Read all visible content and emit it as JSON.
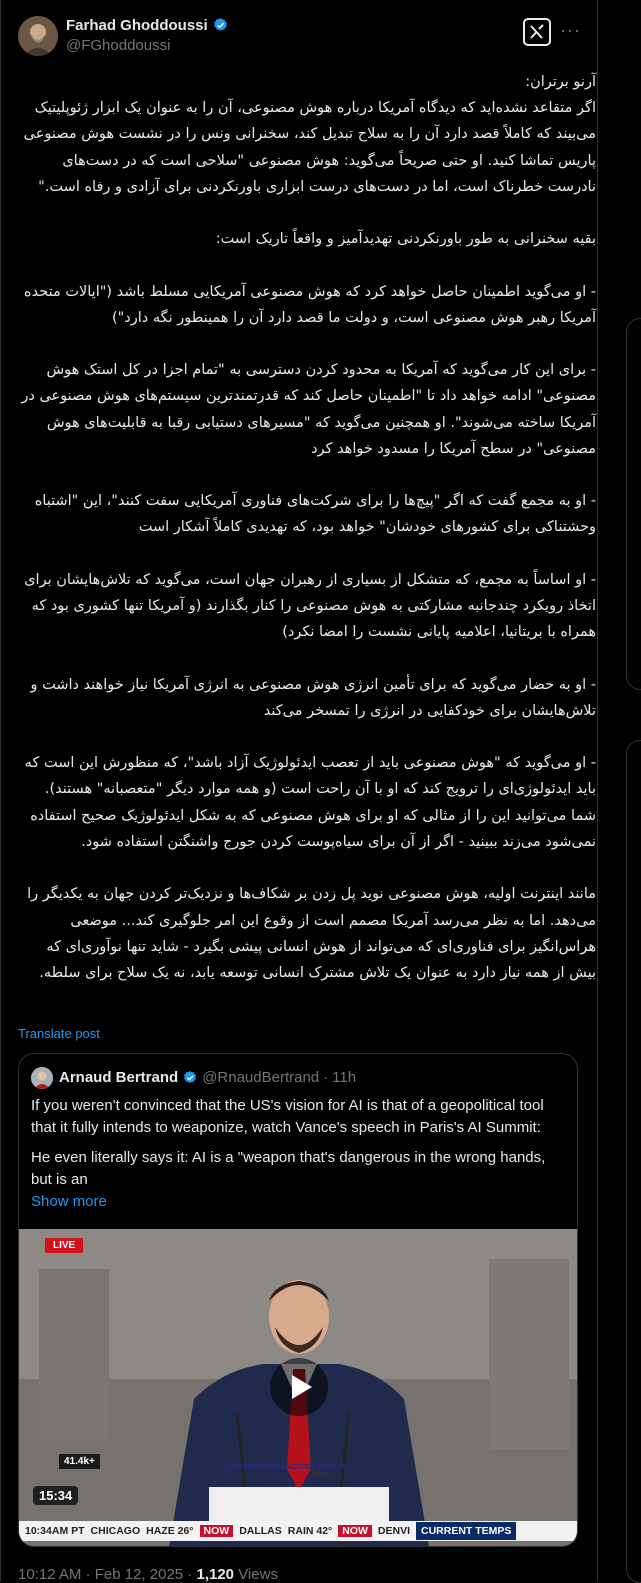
{
  "post": {
    "author_name": "Farhad Ghoddoussi",
    "author_handle": "@FGhoddoussi",
    "text": "آرنو برتران:\nاگر متقاعد نشده‌اید که دیدگاه آمریکا درباره هوش مصنوعی، آن را به عنوان یک ابزار ژئوپلیتیک می‌بیند که کاملاً قصد دارد آن را به سلاح تبدیل کند، سخنرانی ونس را در نشست هوش مصنوعی پاریس تماشا کنید. او حتی صریحاً می‌گوید: هوش مصنوعی \"سلاحی است که در دست‌های نادرست خطرناک است، اما در دست‌های درست ابزاری باورنکردنی برای آزادی و رفاه است.\"\n\nبقیه سخنرانی به طور باورنکردنی تهدیدآمیز و واقعاً تاریک است:\n\n- او می‌گوید اطمینان حاصل خواهد کرد که هوش مصنوعی آمریکایی مسلط باشد (\"ایالات متحده آمریکا رهبر هوش مصنوعی است، و دولت ما قصد دارد آن را همینطور نگه دارد\")\n\n- برای این کار می‌گوید که آمریکا به محدود کردن دسترسی به \"تمام اجزا در کل استک هوش مصنوعی\" ادامه خواهد داد تا \"اطمینان حاصل کند که قدرتمندترین سیستم‌های هوش مصنوعی در آمریکا ساخته می‌شوند\". او همچنین می‌گوید که \"مسیرهای دستیابی رقبا به قابلیت‌های هوش مصنوعی\" در سطح آمریکا را مسدود خواهد کرد\n\n- او به مجمع گفت که اگر \"پیچ‌ها را برای شرکت‌های فناوری آمریکایی سفت کنند\"، این \"اشتباه وحشتناکی برای کشورهای خودشان\" خواهد بود، که تهدیدی کاملاً آشکار است\n\n- او اساساً به مجمع، که متشکل از بسیاری از رهبران جهان است، می‌گوید که تلاش‌هایشان برای اتخاذ رویکرد چندجانبه مشارکتی به هوش مصنوعی را کنار بگذارند (و آمریکا تنها کشوری بود که همراه با بریتانیا، اعلامیه پایانی نشست را امضا نکرد)\n\n- او به حضار می‌گوید که برای تأمین انرژی هوش مصنوعی به انرژی آمریکا نیاز خواهند داشت و تلاش‌هایشان برای خودکفایی در انرژی را تمسخر می‌کند\n\n- او می‌گوید که \"هوش مصنوعی باید از تعصب ایدئولوژیک آزاد باشد\"، که منظورش این است که باید ایدئولوژی‌ای را ترویج کند که او با آن راحت است (و همه موارد دیگر \"متعصبانه\" هستند). شما می‌توانید این را از مثالی که او برای هوش مصنوعی که به شکل ایدئولوژیک صحیح استفاده نمی‌شود می‌زند ببینید - اگر از آن برای سیاه‌پوست کردن جورج واشنگتن استفاده شود.\n\nمانند اینترنت اولیه، هوش مصنوعی نوید پل زدن بر شکاف‌ها و نزدیک‌تر کردن جهان به یکدیگر را می‌دهد. اما به نظر می‌رسد آمریکا مصمم است از وقوع این امر جلوگیری کند... موضعی هراس‌انگیز برای فناوری‌ای که می‌تواند از هوش انسانی پیشی بگیرد - شاید تنها نوآوری‌ای که بیش از همه نیاز دارد به عنوان یک تلاش مشترک انسانی توسعه یابد، نه یک سلاح برای سلطه.",
    "translate_label": "Translate post"
  },
  "quote": {
    "author_name": "Arnaud Bertrand",
    "author_handle": "@RnaudBertrand",
    "separator": "·",
    "age": "11h",
    "paragraph_1": "If you weren't convinced that the US's vision for AI is that of a geopolitical tool that it fully intends to weaponize, watch Vance's speech in Paris's AI Summit:",
    "paragraph_2": "He even literally says it: AI is a \"weapon that's dangerous in the wrong hands, but is an",
    "show_more_label": "Show more",
    "video": {
      "live_badge": "LIVE",
      "views_badge": "41.4k+",
      "duration": "15:34",
      "ticker": {
        "time": "10:34AM PT",
        "city_1": "CHICAGO",
        "cond_1": "HAZE 26°",
        "brand_1": "NOW",
        "city_2": "DALLAS",
        "cond_2": "RAIN 42°",
        "brand_2": "NOW",
        "city_3": "DENVI",
        "label": "CURRENT TEMPS"
      },
      "event_logo": "SOMMET POUR L'ACTION SUR L'IA",
      "location": "Paris"
    }
  },
  "footer": {
    "time": "10:12 AM",
    "date": "Feb 12, 2025",
    "views_count": "1,120",
    "views_label": "Views"
  },
  "colors": {
    "background": "#000000",
    "text": "#e7e9ea",
    "muted": "#71767b",
    "link": "#1d9bf0",
    "border": "#2f3336",
    "verified": "#1d9bf0"
  }
}
